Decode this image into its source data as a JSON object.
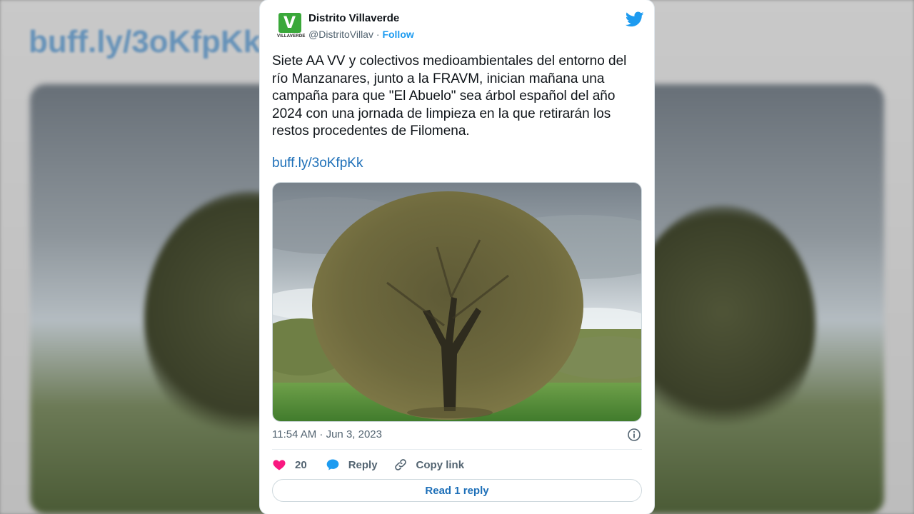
{
  "background": {
    "link_text": "buff.ly/3oKfpKk"
  },
  "tweet": {
    "author": {
      "display_name": "Distrito Villaverde",
      "handle": "@DistritoVillav",
      "separator": " · ",
      "follow_label": "Follow",
      "logo_text": "VILLAVERDE"
    },
    "body": "Siete AA VV y colectivos medioambientales del entorno del río Manzanares, junto a la FRAVM, inician mañana una campaña para que \"El Abuelo\" sea árbol español del año 2024 con una jornada de limpieza en la que retirarán los restos procedentes de Filomena.",
    "link": "buff.ly/3oKfpKk",
    "timestamp": "11:54 AM · Jun 3, 2023",
    "likes_count": "20",
    "reply_label": "Reply",
    "copy_link_label": "Copy link",
    "read_replies_label": "Read 1 reply"
  },
  "icons": {
    "platform": "twitter-bird-icon",
    "info": "info-icon",
    "like": "heart-icon",
    "reply": "speech-bubble-icon",
    "copy": "link-icon"
  },
  "colors": {
    "twitter_blue": "#1d9bf0",
    "heart": "#f91880",
    "text": "#0f1419",
    "muted": "#536471"
  }
}
